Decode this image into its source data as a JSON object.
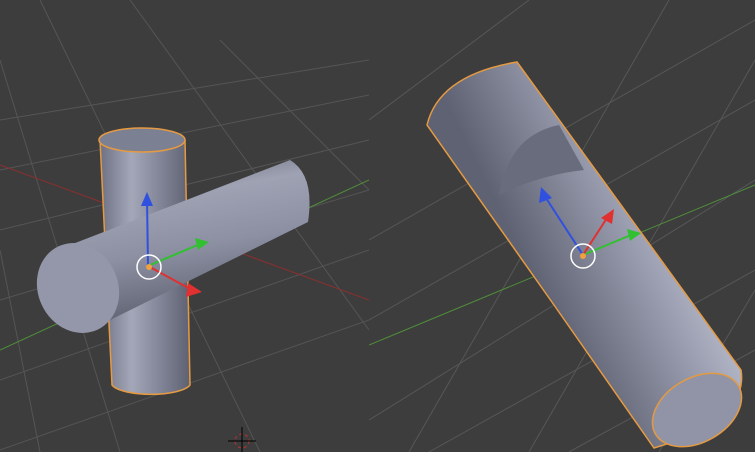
{
  "colors": {
    "background": "#3d3d3d",
    "grid": "#555555",
    "x_axis": "#8a2f2f",
    "y_axis": "#4f8f3a",
    "mesh": "#8e93a6",
    "selection_outline": "#e59a42",
    "gizmo_x": "#e03030",
    "gizmo_y": "#30c030",
    "gizmo_z": "#3050e0"
  },
  "viewports": [
    {
      "name": "left-viewport",
      "object": "crossed-cylinders"
    },
    {
      "name": "right-viewport",
      "object": "cut-cylinder"
    }
  ],
  "icons": [
    "transform-gizmo-icon",
    "object-origin-icon",
    "3d-cursor-icon"
  ]
}
